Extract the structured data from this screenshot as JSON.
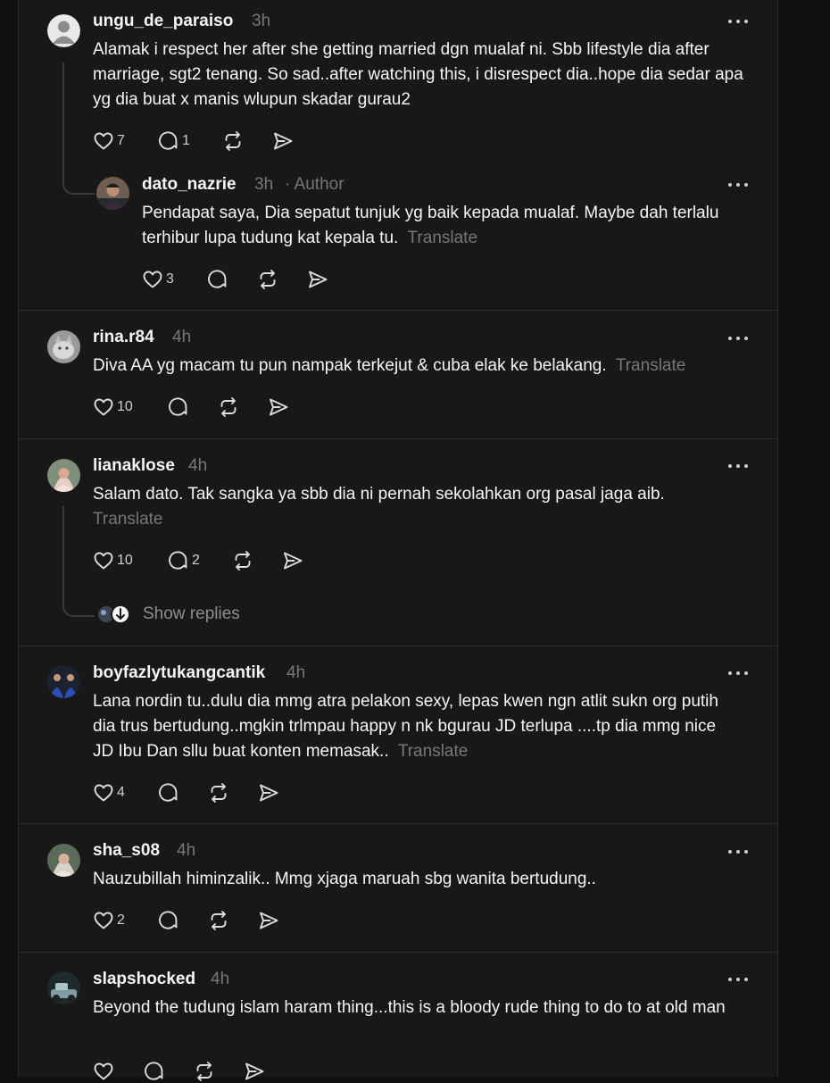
{
  "translate_label": "Translate",
  "author_label": "· Author",
  "show_replies_label": "Show replies",
  "comments": {
    "c1": {
      "username": "ungu_de_paraiso",
      "time": "3h",
      "text": "Alamak i respect her after she getting married dgn mualaf ni. Sbb lifestyle dia after marriage, sgt2 tenang. So sad..after watching this, i disrespect dia..hope dia sedar apa yg dia buat x manis wlupun skadar gurau2",
      "likes": "7",
      "replies": "1"
    },
    "c2": {
      "username": "dato_nazrie",
      "time": "3h",
      "text": "Pendapat saya, Dia sepatut tunjuk yg baik kepada mualaf. Maybe dah terlalu terhibur lupa tudung kat kepala tu.",
      "likes": "3",
      "replies": ""
    },
    "c3": {
      "username": "rina.r84",
      "time": "4h",
      "text": "Diva AA yg macam tu pun nampak terkejut & cuba elak ke belakang.",
      "likes": "10",
      "replies": ""
    },
    "c4": {
      "username": "lianaklose",
      "time": "4h",
      "text": "Salam dato. Tak sangka ya sbb dia ni pernah sekolahkan org pasal jaga aib.",
      "likes": "10",
      "replies": "2"
    },
    "c5": {
      "username": "boyfazlytukangcantik",
      "time": "4h",
      "text": "Lana nordin tu..dulu dia mmg atra pelakon sexy, lepas kwen ngn atlit sukn org putih dia trus bertudung..mgkin trlmpau happy n nk bgurau JD terlupa ....tp dia mmg nice JD Ibu Dan sllu buat konten memasak..",
      "likes": "4",
      "replies": ""
    },
    "c6": {
      "username": "sha_s08",
      "time": "4h",
      "text": "Nauzubillah himinzalik.. Mmg xjaga maruah sbg wanita bertudung..",
      "likes": "2",
      "replies": ""
    },
    "c7": {
      "username": "slapshocked",
      "time": "4h",
      "text": "Beyond the tudung islam haram thing...this is a bloody rude thing to do to at old man",
      "likes": "",
      "replies": ""
    }
  },
  "icons": {
    "like": "heart-icon",
    "reply": "comment-bubble-icon",
    "repost": "repost-icon",
    "share": "send-icon",
    "more": "more-dots-icon"
  },
  "colors": {
    "background": "#101010",
    "panel": "#181818",
    "text": "#f3f5f7",
    "muted": "#777777",
    "divider": "#2d2d2d"
  }
}
